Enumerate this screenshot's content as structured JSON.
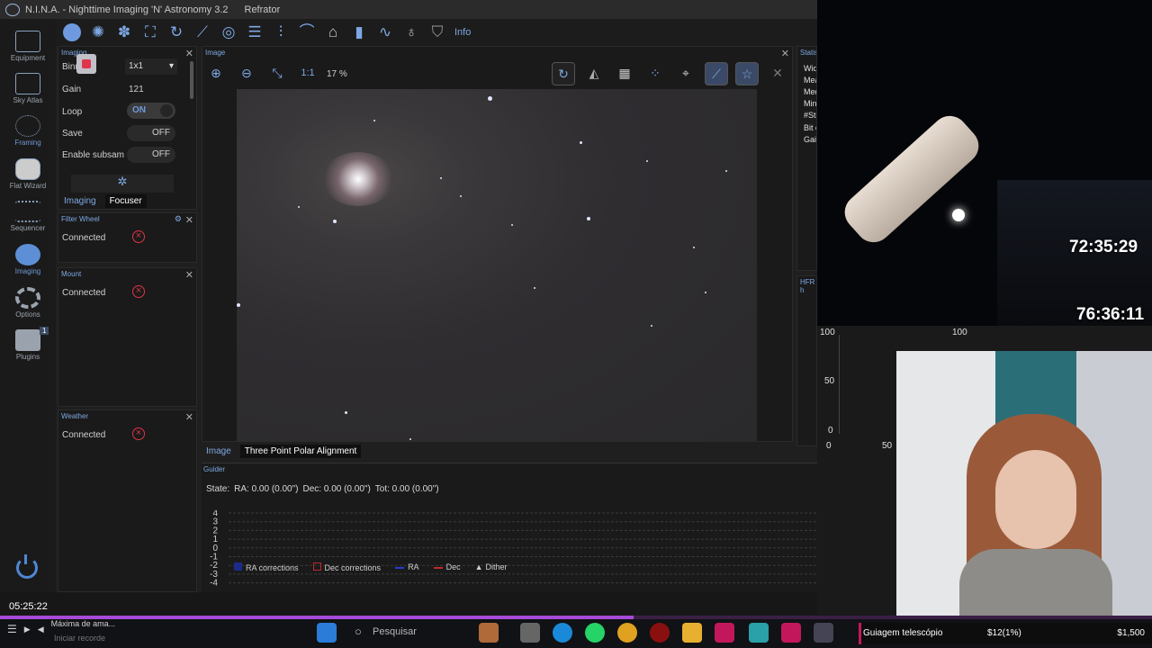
{
  "window": {
    "title": "N.I.N.A. - Nighttime Imaging 'N' Astronomy 3.2",
    "profile": "Refrator"
  },
  "sidebar": {
    "items": [
      {
        "label": "Equipment",
        "icon": "telescope-icon"
      },
      {
        "label": "Sky Atlas",
        "icon": "atlas-icon"
      },
      {
        "label": "Framing",
        "icon": "framing-icon"
      },
      {
        "label": "Flat Wizard",
        "icon": "flat-wizard-icon"
      },
      {
        "label": "Sequencer",
        "icon": "sequencer-icon"
      },
      {
        "label": "Imaging",
        "icon": "imaging-icon",
        "active": true
      },
      {
        "label": "Options",
        "icon": "gear-icon"
      },
      {
        "label": "Plugins",
        "icon": "puzzle-icon",
        "badge": "1"
      }
    ]
  },
  "toolbar": {
    "info_label": "Info"
  },
  "imaging_panel": {
    "title": "Imaging",
    "binning_label": "Binn",
    "binning_value": "1x1",
    "gain_label": "Gain",
    "gain_value": "121",
    "loop_label": "Loop",
    "loop_state": "ON",
    "save_label": "Save",
    "save_state": "OFF",
    "subsample_label": "Enable subsam",
    "subsample_state": "OFF",
    "tabs": [
      "Imaging",
      "Focuser"
    ]
  },
  "filter_wheel": {
    "title": "Filter Wheel",
    "status": "Connected"
  },
  "mount": {
    "title": "Mount",
    "status": "Connected"
  },
  "weather": {
    "title": "Weather",
    "status": "Connected"
  },
  "image_panel": {
    "title": "Image",
    "one_to_one": "1:1",
    "zoom": "17 %",
    "tabs": [
      "Image",
      "Three Point Polar Alignment"
    ]
  },
  "statistics": {
    "title": "Statist",
    "lines": [
      "Wid",
      "Mea",
      "Med",
      "Min",
      "#Sta",
      "Bit d",
      "Gain"
    ]
  },
  "hfr": {
    "title": "HFR h",
    "y_ticks": [
      "100",
      "50",
      "0"
    ],
    "x_ticks": [
      "0",
      "50",
      "100"
    ]
  },
  "guider": {
    "title": "Guider",
    "state_label": "State:",
    "ra": "RA: 0.00 (0.00\")",
    "dec": "Dec: 0.00 (0.00\")",
    "tot": "Tot: 0.00 (0.00\")",
    "y_ticks": [
      "4",
      "3",
      "2",
      "1",
      "0",
      "-1",
      "-2",
      "-3",
      "-4"
    ],
    "legend": [
      "RA corrections",
      "Dec corrections",
      "RA",
      "Dec",
      "Dither"
    ]
  },
  "clock": "05:25:22",
  "overlay": {
    "timer1": "72:35:29",
    "timer2": "76:36:11"
  },
  "taskbar": {
    "search_placeholder": "Pesquisar",
    "media_title": "Máxima de ama...",
    "media_sub": "Iniciar recorde"
  },
  "stream_goal": {
    "label": "Guiagem telescópio",
    "progress": "$12(1%)",
    "goal": "$1,500",
    "fraction": 0.01
  },
  "colors": {
    "accent": "#7ea8e4",
    "error": "#e0344a",
    "progress": "#a64ad8"
  }
}
